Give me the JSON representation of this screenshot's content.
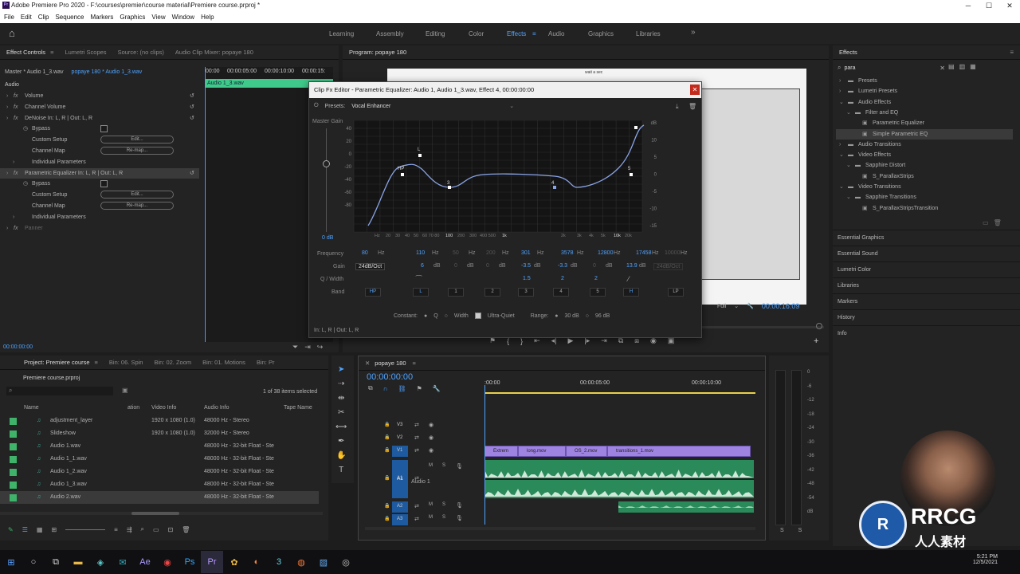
{
  "titlebar": {
    "title": "Adobe Premiere Pro 2020 - F:\\courses\\premier\\course material\\Premiere course.prproj *",
    "icon": "Pr",
    "min": "─",
    "max": "☐",
    "close": "✕"
  },
  "menu": [
    "File",
    "Edit",
    "Clip",
    "Sequence",
    "Markers",
    "Graphics",
    "View",
    "Window",
    "Help"
  ],
  "workspaces": [
    "Learning",
    "Assembly",
    "Editing",
    "Color",
    "Effects",
    "Audio",
    "Graphics",
    "Libraries"
  ],
  "workspace_active": "Effects",
  "effect_controls": {
    "tabs": [
      "Effect Controls",
      "Lumetri Scopes",
      "Source: (no clips)",
      "Audio Clip Mixer: popaye 180"
    ],
    "master": "Master * Audio 1_3.wav",
    "clip": "popaye 180 * Audio 1_3.wav",
    "time_ruler": [
      "00:00",
      "00:00:05:00",
      "00:00:10:00",
      "00:00:15:"
    ],
    "clip_label": "Audio 1_3.wav",
    "section": "Audio",
    "rows": [
      {
        "label": "Volume",
        "fx": true,
        "indent": 0
      },
      {
        "label": "Channel Volume",
        "fx": true,
        "indent": 0
      },
      {
        "label": "DeNoise In: L, R | Out: L, R",
        "fx": true,
        "indent": 0
      },
      {
        "label": "Bypass",
        "indent": 1,
        "checkbox": true
      },
      {
        "label": "Custom Setup",
        "indent": 1,
        "button": "Edit..."
      },
      {
        "label": "Channel Map",
        "indent": 1,
        "button": "Re-map..."
      },
      {
        "label": "Individual Parameters",
        "indent": 1
      },
      {
        "label": "Parametric Equalizer In: L, R | Out: L, R",
        "fx": true,
        "indent": 0,
        "selected": true
      },
      {
        "label": "Bypass",
        "indent": 1,
        "checkbox": true
      },
      {
        "label": "Custom Setup",
        "indent": 1,
        "button": "Edit..."
      },
      {
        "label": "Channel Map",
        "indent": 1,
        "button": "Re-map..."
      },
      {
        "label": "Individual Parameters",
        "indent": 1
      },
      {
        "label": "Panner",
        "fx": true,
        "indent": 0,
        "dim": true
      }
    ],
    "timecode": "00:00:00:00"
  },
  "program": {
    "title": "Program: popaye 180",
    "fit": "Full",
    "timecode": "00:00:16:09",
    "frame_text": "wait a sec"
  },
  "eq": {
    "title": "Clip Fx Editor - Parametric Equalizer: Audio 1, Audio 1_3.wav, Effect 4, 00:00:00:00",
    "presets_label": "Presets:",
    "preset": "Vocal Enhancer",
    "master_gain": "Master Gain",
    "master_gain_value": "0 dB",
    "y_left": [
      "40",
      "20",
      "0",
      "-20",
      "-40",
      "-60",
      "-80"
    ],
    "y_right": [
      "dB",
      "10",
      "5",
      "0",
      "-5",
      "-10",
      "-15"
    ],
    "x_ticks": [
      "Hz",
      "20",
      "30",
      "40",
      "50",
      "60 70 80",
      "100",
      "200",
      "300",
      "400 500",
      "1k",
      "2k",
      "3k",
      "4k",
      "5k",
      "10k",
      "20k"
    ],
    "points": [
      "HP",
      "L",
      "3",
      "4",
      "5"
    ],
    "rows_labels": {
      "frequency": "Frequency",
      "gain": "Gain",
      "q": "Q / Width",
      "band": "Band"
    },
    "frequency": [
      "80",
      "110",
      "50",
      "200",
      "301",
      "3578",
      "12800",
      "17458",
      "10000"
    ],
    "gain_slope": "24dB/Oct",
    "gain": [
      "6",
      "0",
      "0",
      "-3.5",
      "-3.3",
      "0",
      "13.9"
    ],
    "gain_slope_right": "24dB/Oct",
    "q": [
      "1.5",
      "2",
      "2"
    ],
    "bands": [
      "HP",
      "L",
      "1",
      "2",
      "3",
      "4",
      "5",
      "H",
      "LP"
    ],
    "constant_label": "Constant:",
    "q_label": "Q",
    "width_label": "Width",
    "ultra_quiet": "Ultra-Quiet",
    "range_label": "Range:",
    "range1": "30 dB",
    "range2": "96 dB",
    "io": "In: L, R | Out: L, R",
    "hz": "Hz",
    "db": "dB"
  },
  "effects_panel": {
    "title": "Effects",
    "search": "para",
    "tree": [
      {
        "label": "Presets",
        "indent": 0
      },
      {
        "label": "Lumetri Presets",
        "indent": 0
      },
      {
        "label": "Audio Effects",
        "indent": 0,
        "open": true
      },
      {
        "label": "Filter and EQ",
        "indent": 1,
        "open": true
      },
      {
        "label": "Parametric Equalizer",
        "indent": 2,
        "fx": true
      },
      {
        "label": "Simple Parametric EQ",
        "indent": 2,
        "fx": true,
        "selected": true
      },
      {
        "label": "Audio Transitions",
        "indent": 0
      },
      {
        "label": "Video Effects",
        "indent": 0,
        "open": true
      },
      {
        "label": "Sapphire Distort",
        "indent": 1,
        "open": true
      },
      {
        "label": "S_ParallaxStrips",
        "indent": 2,
        "fx": true
      },
      {
        "label": "Video Transitions",
        "indent": 0,
        "open": true
      },
      {
        "label": "Sapphire Transitions",
        "indent": 1,
        "open": true
      },
      {
        "label": "S_ParallaxStripsTransition",
        "indent": 2,
        "fx": true
      }
    ],
    "collapsed": [
      "Essential Graphics",
      "Essential Sound",
      "Lumetri Color",
      "Libraries",
      "Markers",
      "History",
      "Info"
    ]
  },
  "project": {
    "tabs": [
      "Project: Premiere course",
      "Bin: 06. Spin",
      "Bin: 02. Zoom",
      "Bin: 01. Motions",
      "Bin: Pr"
    ],
    "file": "Premiere course.prproj",
    "count": "1 of 38 items selected",
    "cols": [
      "Name",
      "ation",
      "Video Info",
      "Audio Info",
      "Tape Name"
    ],
    "items": [
      {
        "name": "adjustment_layer",
        "video": "1920 x 1080 (1.0)",
        "audio": "48000 Hz - Stereo",
        "color": "#3fb36a"
      },
      {
        "name": "Slideshow",
        "video": "1920 x 1080 (1.0)",
        "audio": "32000 Hz - Stereo",
        "color": "#3fb36a"
      },
      {
        "name": "Audio 1.wav",
        "video": "",
        "audio": "48000 Hz - 32-bit Float - Ste",
        "color": "#3fb36a"
      },
      {
        "name": "Audio 1_1.wav",
        "video": "",
        "audio": "48000 Hz - 32-bit Float - Ste",
        "color": "#3fb36a"
      },
      {
        "name": "Audio 1_2.wav",
        "video": "",
        "audio": "48000 Hz - 32-bit Float - Ste",
        "color": "#3fb36a"
      },
      {
        "name": "Audio 1_3.wav",
        "video": "",
        "audio": "48000 Hz - 32-bit Float - Ste",
        "color": "#3fb36a"
      },
      {
        "name": "Audio 2.wav",
        "video": "",
        "audio": "48000 Hz - 32-bit Float - Ste",
        "color": "#3fb36a",
        "selected": true
      }
    ]
  },
  "timeline": {
    "tab": "popaye 180",
    "timecode": "00:00:00:00",
    "ruler": [
      ":00:00",
      "00:00:05:00",
      "00:00:10:00"
    ],
    "tracks": [
      "V3",
      "V2",
      "V1",
      "A1",
      "A2",
      "A3"
    ],
    "audio_label": "Audio 1",
    "clips_v1": [
      "Extrem",
      "long.mov",
      "OS_2.mov",
      "transitions_1.mov"
    ],
    "meter": [
      "0",
      "-6",
      "-12",
      "-18",
      "-24",
      "-30",
      "-36",
      "-42",
      "-48",
      "-54",
      "dB"
    ],
    "meter_ss": [
      "S",
      "S"
    ]
  },
  "taskbar": {
    "time": "5:21 PM",
    "date": "12/5/2021"
  },
  "watermark": {
    "brand": "RRCG",
    "sub": "人人素材"
  }
}
